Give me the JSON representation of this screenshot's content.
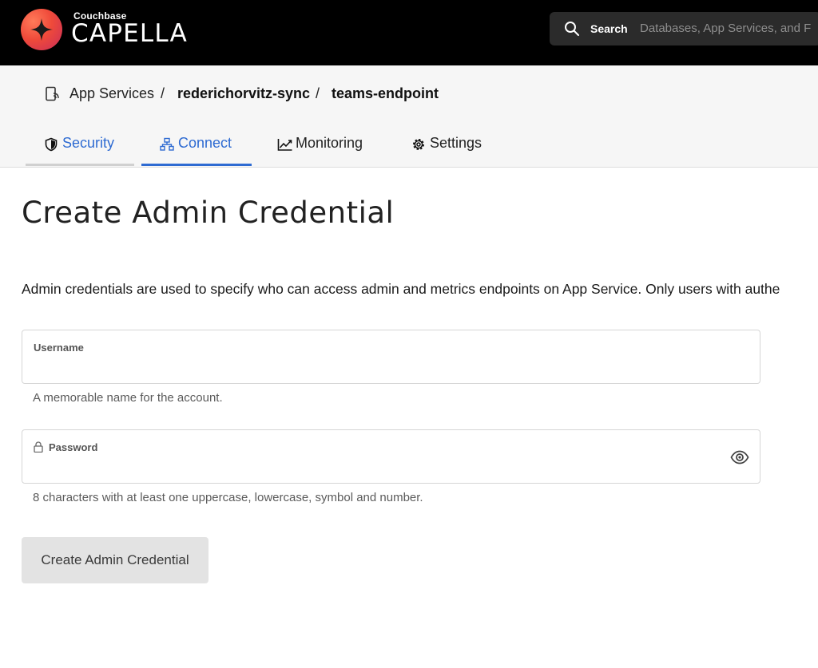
{
  "brand": {
    "small": "Couchbase",
    "name": "CAPELLA"
  },
  "search": {
    "label": "Search",
    "placeholder": "Databases, App Services, and F"
  },
  "breadcrumb": {
    "items": [
      "App Services",
      "rederichorvitz-sync",
      "teams-endpoint"
    ],
    "separator": "/"
  },
  "tabs": [
    {
      "label": "Security",
      "icon": "shield-icon",
      "state": "default"
    },
    {
      "label": "Connect",
      "icon": "network-icon",
      "state": "active"
    },
    {
      "label": "Monitoring",
      "icon": "chart-line-icon",
      "state": "default"
    },
    {
      "label": "Settings",
      "icon": "gear-icon",
      "state": "default"
    }
  ],
  "main": {
    "title": "Create Admin Credential",
    "description": "Admin credentials are used to specify who can access admin and metrics endpoints on App Service. Only users with authe"
  },
  "form": {
    "username": {
      "label": "Username",
      "value": "",
      "helper": "A memorable name for the account."
    },
    "password": {
      "label": "Password",
      "value": "",
      "helper": "8 characters with at least one uppercase, lowercase, symbol and number."
    },
    "submit_label": "Create Admin Credential"
  },
  "colors": {
    "accent": "#2e6bd2",
    "topbar": "#000000",
    "header_bg": "#f6f6f6",
    "button_bg": "#e3e3e3"
  }
}
